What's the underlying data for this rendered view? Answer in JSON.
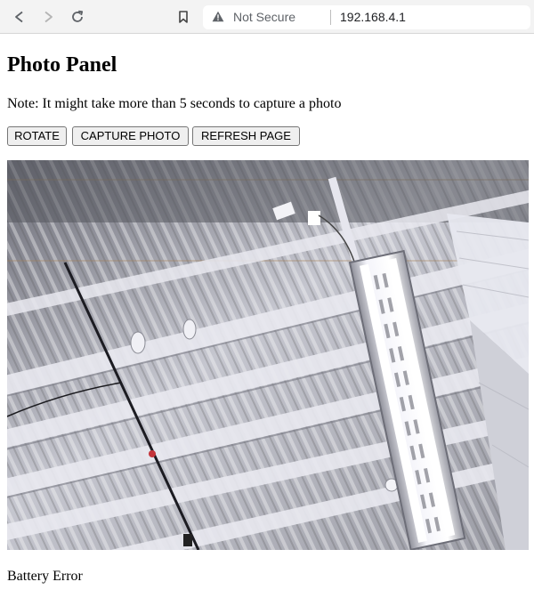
{
  "browser": {
    "security_label": "Not Secure",
    "url": "192.168.4.1",
    "icons": [
      "back-arrow-icon",
      "forward-arrow-icon",
      "reload-icon",
      "bookmark-icon",
      "warning-triangle-icon"
    ]
  },
  "page": {
    "title": "Photo Panel",
    "note": "Note: It might take more than 5 seconds to capture a photo",
    "buttons": {
      "rotate": "ROTATE",
      "capture": "CAPTURE PHOTO",
      "refresh": "REFRESH PAGE"
    },
    "status": "Battery Error"
  }
}
